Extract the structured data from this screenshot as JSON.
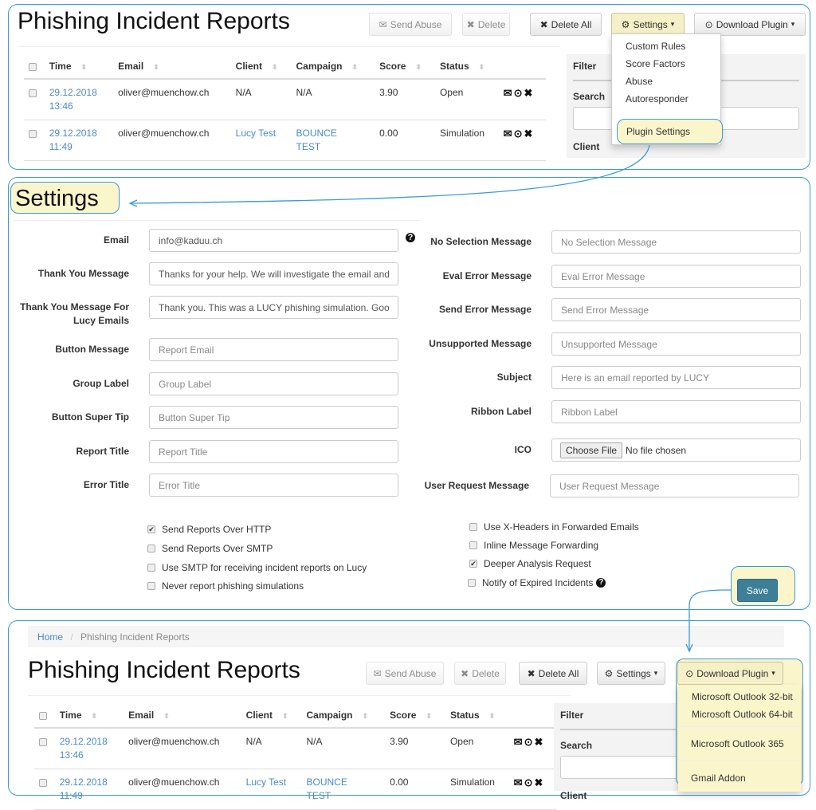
{
  "colors": {
    "accent": "#3a9ad9",
    "highlight": "#fbf5cc",
    "save": "#3d7f96",
    "link": "#4a8ac8"
  },
  "report": {
    "title": "Phishing Incident Reports",
    "buttons": {
      "send_abuse": "Send Abuse",
      "delete": "Delete",
      "delete_all": "Delete All",
      "settings": "Settings",
      "download_plugin": "Download Plugin"
    },
    "columns": [
      "Time",
      "Email",
      "Client",
      "Campaign",
      "Score",
      "Status"
    ],
    "rows": [
      {
        "time": "29.12.2018 13:46",
        "email": "oliver@muenchow.ch",
        "client": "N/A",
        "campaign": "N/A",
        "score": "3.90",
        "status": "Open",
        "client_link": false
      },
      {
        "time": "29.12.2018 11:49",
        "email": "oliver@muenchow.ch",
        "client": "Lucy Test",
        "campaign": "BOUNCE TEST",
        "score": "0.00",
        "status": "Simulation",
        "client_link": true
      }
    ],
    "row_icons": [
      "envelope-icon",
      "download-icon",
      "close-icon"
    ],
    "filter": {
      "title": "Filter",
      "search": "Search",
      "client": "Client"
    },
    "settings_menu": [
      "Custom Rules",
      "Score Factors",
      "Abuse",
      "Autoresponder",
      "Plugin Settings"
    ],
    "download_menu": [
      "Microsoft Outlook 32-bit",
      "Microsoft Outlook 64-bit",
      "Microsoft Outlook 365",
      "Gmail Addon"
    ]
  },
  "breadcrumb": [
    "Home",
    "Phishing Incident Reports"
  ],
  "settings": {
    "title": "Settings",
    "left": [
      {
        "label": "Email",
        "value": "info@kaduu.ch",
        "filled": true
      },
      {
        "label": "Thank You Message",
        "value": "Thanks for your help. We will investigate the email and",
        "filled": true
      },
      {
        "label": "Thank You Message For Lucy Emails",
        "value": "Thank you. This was a LUCY phishing simulation. Goo",
        "filled": true
      },
      {
        "label": "Button Message",
        "value": "Report Email"
      },
      {
        "label": "Group Label",
        "value": "Group Label"
      },
      {
        "label": "Button Super Tip",
        "value": "Button Super Tip"
      },
      {
        "label": "Report Title",
        "value": "Report Title"
      },
      {
        "label": "Error Title",
        "value": "Error Title"
      }
    ],
    "right": [
      {
        "label": "No Selection Message",
        "value": "No Selection Message"
      },
      {
        "label": "Eval Error Message",
        "value": "Eval Error Message"
      },
      {
        "label": "Send Error Message",
        "value": "Send Error Message"
      },
      {
        "label": "Unsupported Message",
        "value": "Unsupported Message"
      },
      {
        "label": "Subject",
        "value": "Here is an email reported by LUCY"
      },
      {
        "label": "Ribbon Label",
        "value": "Ribbon Label"
      },
      {
        "label": "ICO",
        "file_button": "Choose File",
        "value": "No file chosen"
      },
      {
        "label": "User Request Message",
        "value": "User Request Message"
      }
    ],
    "checks_left": [
      {
        "label": "Send Reports Over HTTP",
        "checked": true
      },
      {
        "label": "Send Reports Over SMTP",
        "checked": false
      },
      {
        "label": "Use SMTP for receiving incident reports on Lucy",
        "checked": false
      },
      {
        "label": "Never report phishing simulations",
        "checked": false
      }
    ],
    "checks_right": [
      {
        "label": "Use X-Headers in Forwarded Emails",
        "checked": false
      },
      {
        "label": "Inline Message Forwarding",
        "checked": false
      },
      {
        "label": "Deeper Analysis Request",
        "checked": true
      },
      {
        "label": "Notify of Expired Incidents",
        "checked": false,
        "help": true
      }
    ],
    "save": "Save"
  }
}
